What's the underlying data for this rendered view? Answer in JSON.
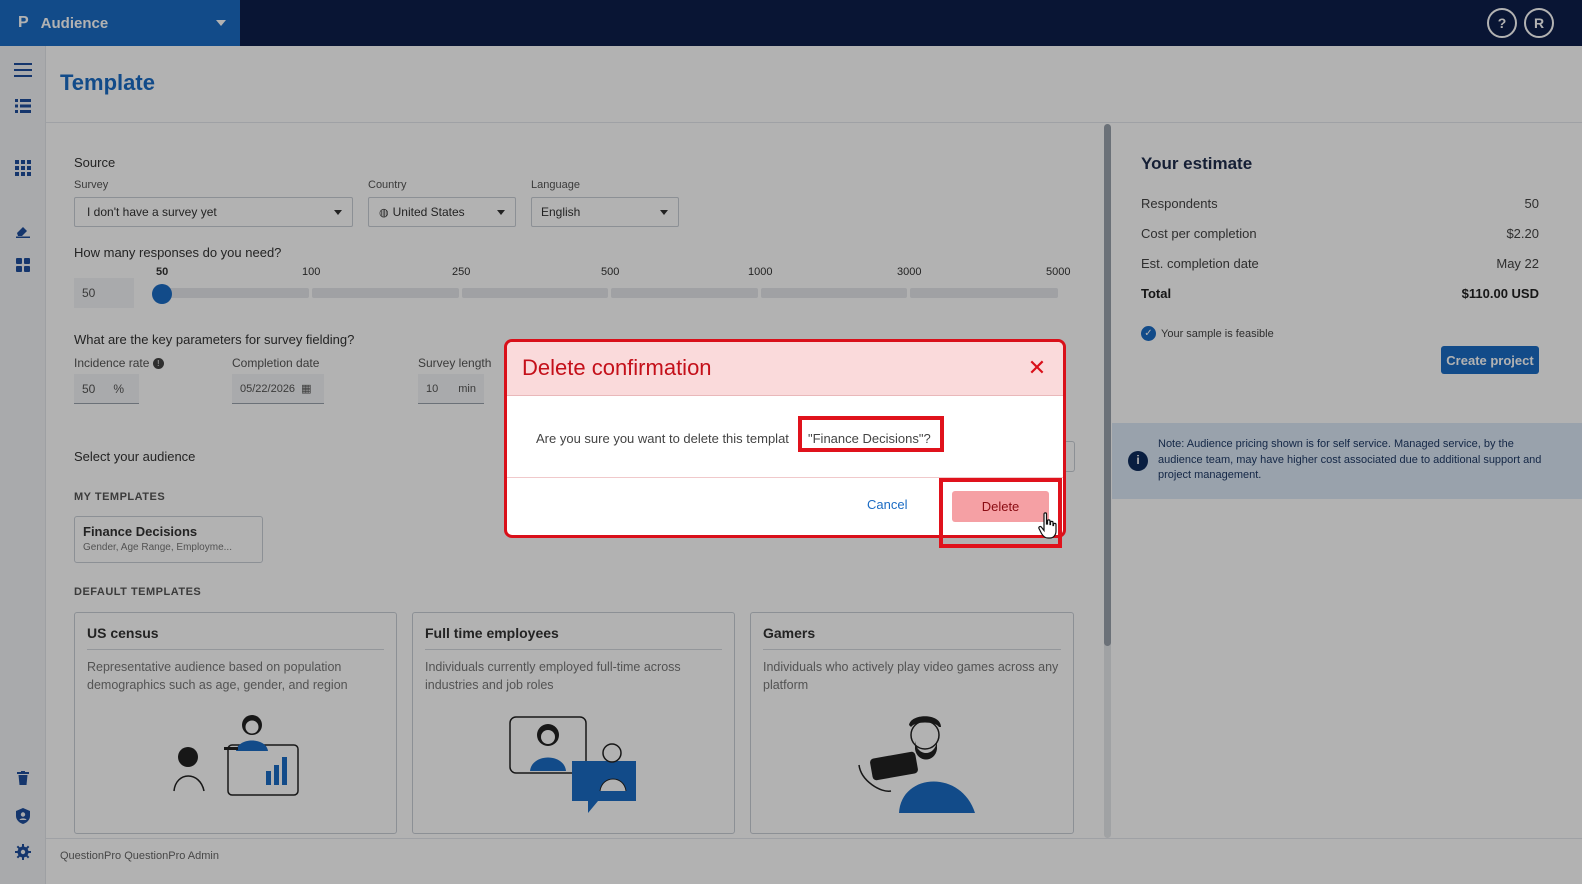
{
  "app": {
    "logo": "P",
    "name": "Audience"
  },
  "topbar": {
    "help_label": "?",
    "avatar_initial": "R"
  },
  "page": {
    "title": "Template"
  },
  "source": {
    "heading": "Source",
    "survey_label": "Survey",
    "survey_value": "I don't have a survey yet",
    "country_label": "Country",
    "country_value": "United States",
    "language_label": "Language",
    "language_value": "English"
  },
  "responses": {
    "question": "How many responses do you need?",
    "value": "50",
    "ticks": [
      "50",
      "100",
      "250",
      "500",
      "1000",
      "3000",
      "5000"
    ],
    "selected": "50"
  },
  "fielding": {
    "question": "What are the key parameters for survey fielding?",
    "incidence_label": "Incidence rate",
    "incidence_value": "50",
    "incidence_unit": "%",
    "completion_label": "Completion date",
    "completion_value": "05/22/2026",
    "length_label": "Survey length",
    "length_value": "10",
    "length_unit": "min"
  },
  "audience": {
    "heading": "Select your audience",
    "my_templates_label": "MY TEMPLATES",
    "my_templates": [
      {
        "name": "Finance Decisions",
        "desc": "Gender, Age Range, Employme..."
      }
    ],
    "default_templates_label": "DEFAULT TEMPLATES",
    "default_templates": [
      {
        "name": "US census",
        "desc": "Representative audience based on population demographics such as age, gender, and region"
      },
      {
        "name": "Full time employees",
        "desc": "Individuals currently employed full-time across industries and job roles"
      },
      {
        "name": "Gamers",
        "desc": "Individuals who actively play video games across any platform"
      }
    ]
  },
  "estimate": {
    "title": "Your estimate",
    "rows": [
      {
        "label": "Respondents",
        "value": "50"
      },
      {
        "label": "Cost per completion",
        "value": "$2.20"
      },
      {
        "label": "Est. completion date",
        "value": "May 22"
      },
      {
        "label": "Total",
        "value": "$110.00 USD"
      }
    ],
    "feasible_text": "Your sample is feasible",
    "create_label": "Create project",
    "note": "Note: Audience pricing shown is for self service. Managed service, by the audience team, may have higher cost associated due to additional support and project management."
  },
  "footer": {
    "text": "QuestionPro QuestionPro Admin"
  },
  "modal": {
    "title": "Delete confirmation",
    "close_glyph": "✕",
    "message": "Are you sure you want to delete this templat",
    "quoted_name": "\"Finance Decisions\"?",
    "cancel_label": "Cancel",
    "delete_label": "Delete"
  },
  "colors": {
    "brand_blue": "#1b6cc4",
    "topbar_navy": "#0e1f4b",
    "danger_red": "#d9101a",
    "highlight_red": "#e0121c"
  }
}
